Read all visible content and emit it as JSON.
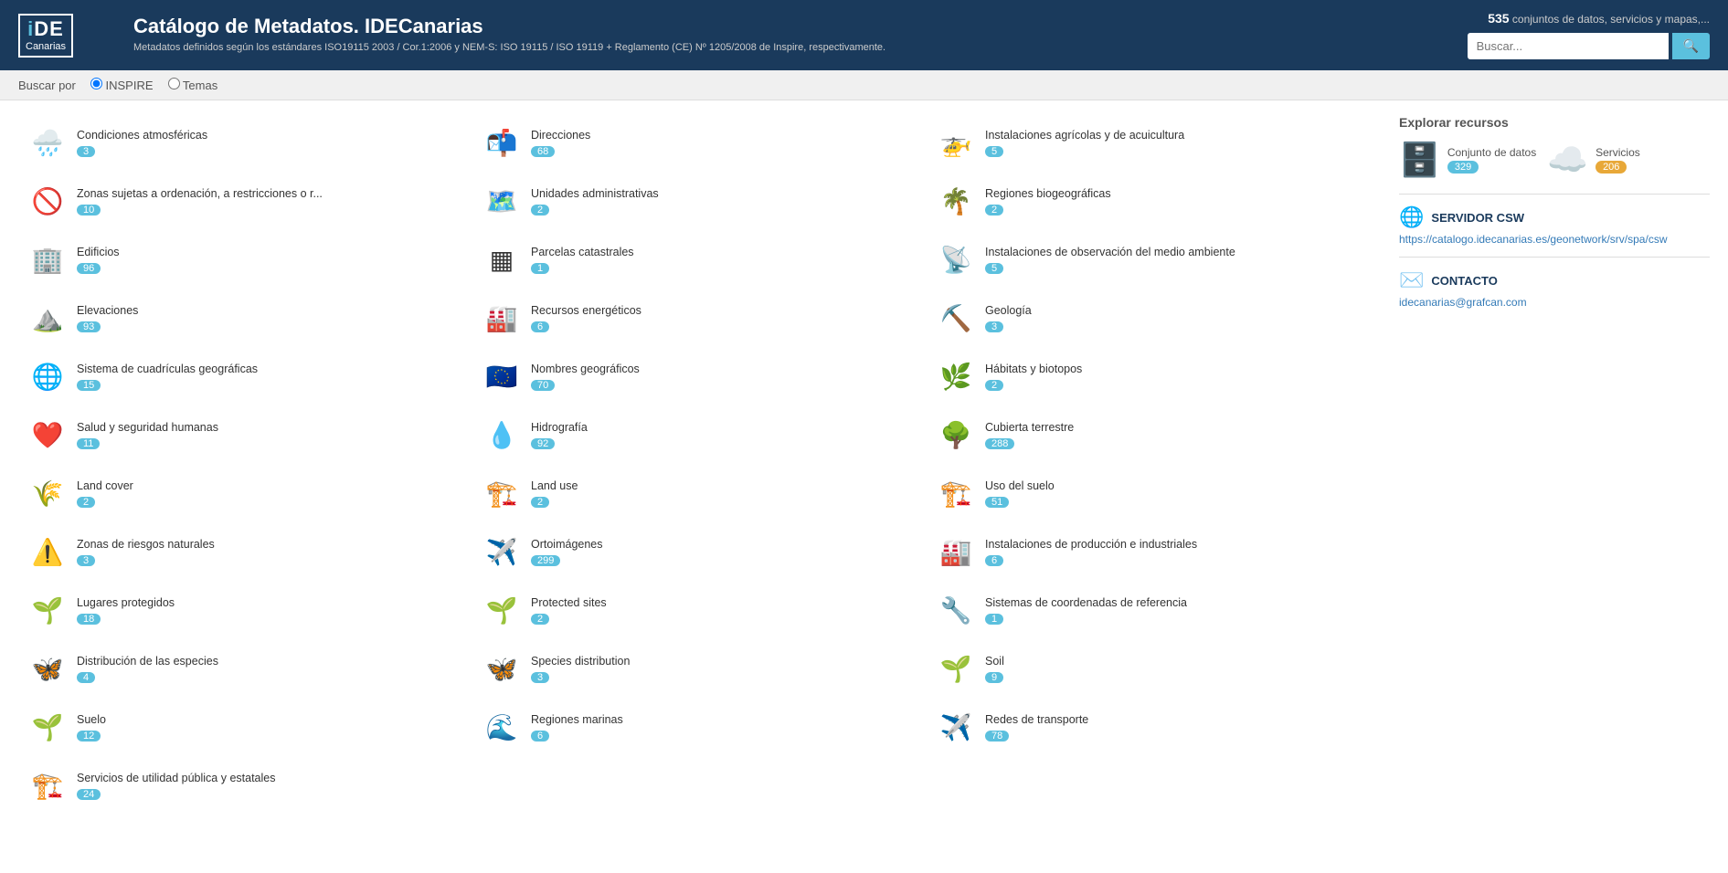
{
  "header": {
    "logo_ide": "iDE",
    "logo_canarias": "Canarias",
    "title": "Catálogo de Metadatos. IDECanarias",
    "subtitle": "Metadatos definidos según los estándares ISO19115 2003 / Cor.1:2006 y NEM-S: ISO 19115 / ISO 19119 + Reglamento (CE) Nº 1205/2008 de Inspire, respectivamente.",
    "count_text": "conjuntos de datos, servicios y mapas,...",
    "count_number": "535",
    "search_placeholder": "Buscar...",
    "search_btn_label": "🔍"
  },
  "subheader": {
    "buscar_por": "Buscar por",
    "radio_inspire": "INSPIRE",
    "radio_temas": "Temas"
  },
  "categories": [
    {
      "name": "Condiciones atmosféricas",
      "count": "3",
      "icon": "🌧️",
      "color": "blue"
    },
    {
      "name": "Direcciones",
      "count": "68",
      "icon": "📬",
      "color": "orange"
    },
    {
      "name": "Instalaciones agrícolas y de acuicultura",
      "count": "5",
      "icon": "🚁",
      "color": "orange"
    },
    {
      "name": "Zonas sujetas a ordenación, a restricciones o r...",
      "count": "10",
      "icon": "🚫",
      "color": "red"
    },
    {
      "name": "Unidades administrativas",
      "count": "2",
      "icon": "🗺️",
      "color": "red"
    },
    {
      "name": "Regiones biogeográficas",
      "count": "2",
      "icon": "🌴",
      "color": "green"
    },
    {
      "name": "Edificios",
      "count": "96",
      "icon": "🏢",
      "color": "gray"
    },
    {
      "name": "Parcelas catastrales",
      "count": "1",
      "icon": "▦",
      "color": "gray"
    },
    {
      "name": "Instalaciones de observación del medio ambiente",
      "count": "5",
      "icon": "📡",
      "color": "blue"
    },
    {
      "name": "Elevaciones",
      "count": "93",
      "icon": "⛰️",
      "color": "orange"
    },
    {
      "name": "Recursos energéticos",
      "count": "6",
      "icon": "🏭",
      "color": "orange"
    },
    {
      "name": "Geología",
      "count": "3",
      "icon": "⛏️",
      "color": "orange"
    },
    {
      "name": "Sistema de cuadrículas geográficas",
      "count": "15",
      "icon": "🌐",
      "color": "gray"
    },
    {
      "name": "Nombres geográficos",
      "count": "70",
      "icon": "🇪🇺",
      "color": "blue"
    },
    {
      "name": "Hábitats y biotopos",
      "count": "2",
      "icon": "🌿",
      "color": "green"
    },
    {
      "name": "Salud y seguridad humanas",
      "count": "11",
      "icon": "❤️",
      "color": "red"
    },
    {
      "name": "Hidrografía",
      "count": "92",
      "icon": "💧",
      "color": "blue"
    },
    {
      "name": "Cubierta terrestre",
      "count": "288",
      "icon": "🌳",
      "color": "green"
    },
    {
      "name": "Land cover",
      "count": "2",
      "icon": "🌾",
      "color": "green"
    },
    {
      "name": "Land use",
      "count": "2",
      "icon": "🏗️",
      "color": "orange"
    },
    {
      "name": "Uso del suelo",
      "count": "51",
      "icon": "🏗️",
      "color": "orange"
    },
    {
      "name": "Zonas de riesgos naturales",
      "count": "3",
      "icon": "⚠️",
      "color": "orange"
    },
    {
      "name": "Ortoimágenes",
      "count": "299",
      "icon": "✈️",
      "color": "gray"
    },
    {
      "name": "Instalaciones de producción e industriales",
      "count": "6",
      "icon": "🏭",
      "color": "orange"
    },
    {
      "name": "Lugares protegidos",
      "count": "18",
      "icon": "🌱",
      "color": "green"
    },
    {
      "name": "Protected sites",
      "count": "2",
      "icon": "🌱",
      "color": "green"
    },
    {
      "name": "Sistemas de coordenadas de referencia",
      "count": "1",
      "icon": "🔧",
      "color": "gray"
    },
    {
      "name": "Distribución de las especies",
      "count": "4",
      "icon": "🦋",
      "color": "green"
    },
    {
      "name": "Species distribution",
      "count": "3",
      "icon": "🦋",
      "color": "green"
    },
    {
      "name": "Soil",
      "count": "9",
      "icon": "🌱",
      "color": "green"
    },
    {
      "name": "Suelo",
      "count": "12",
      "icon": "🌱",
      "color": "green"
    },
    {
      "name": "Regiones marinas",
      "count": "6",
      "icon": "🌊",
      "color": "blue"
    },
    {
      "name": "Redes de transporte",
      "count": "78",
      "icon": "✈️",
      "color": "orange"
    },
    {
      "name": "Servicios de utilidad pública y estatales",
      "count": "24",
      "icon": "🏗️",
      "color": "orange"
    }
  ],
  "sidebar": {
    "title": "Explorar recursos",
    "conjunto_label": "Conjunto de datos",
    "conjunto_count": "329",
    "servicios_label": "Servicios",
    "servicios_count": "206",
    "csw_title": "SERVIDOR CSW",
    "csw_url": "https://catalogo.idecanarias.es/geonetwork/srv/spa/csw",
    "contact_title": "CONTACTO",
    "contact_email": "idecanarias@grafcan.com"
  }
}
